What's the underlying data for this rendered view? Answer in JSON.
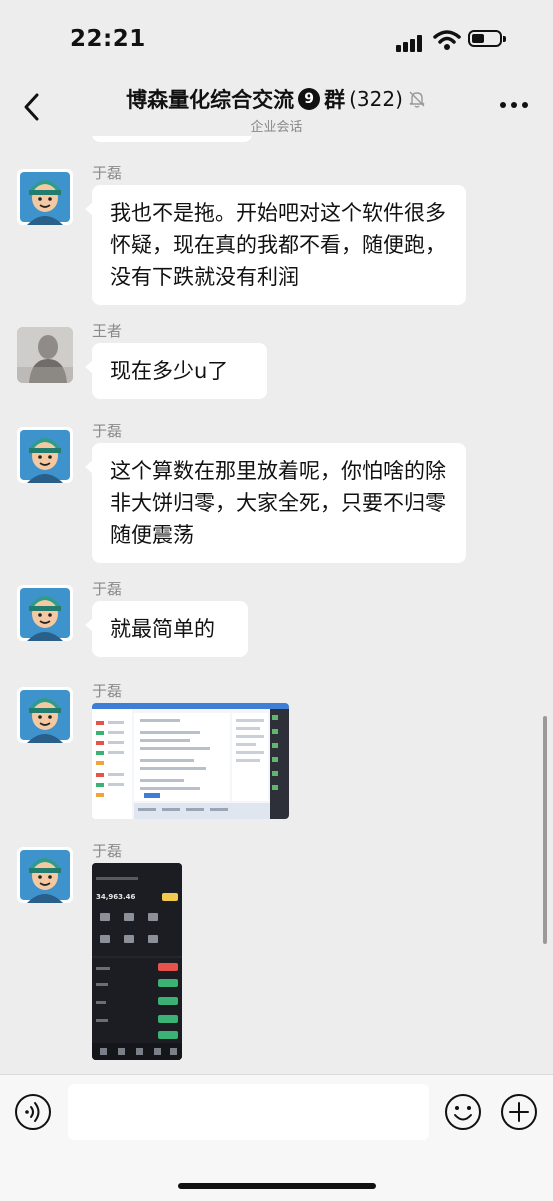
{
  "status_bar": {
    "time": "22:21"
  },
  "header": {
    "title": "博森量化综合交流",
    "title_badge": "9",
    "title_suffix": "群",
    "member_count": "(322)",
    "subtitle": "企业会话",
    "icons": {
      "back": "chevron-left-icon",
      "mute": "bell-slash-icon",
      "more": "more-dots-icon"
    }
  },
  "messages": [
    {
      "sender": "于磊",
      "type": "text",
      "text": "我也不是拖。开始吧对这个软件很多怀疑，现在真的我都不看，随便跑，没有下跌就没有利润"
    },
    {
      "sender": "王者",
      "type": "text",
      "text": "现在多少u了"
    },
    {
      "sender": "于磊",
      "type": "text",
      "text": "这个算数在那里放着呢，你怕啥的除非大饼归零，大家全死，只要不归零随便震荡"
    },
    {
      "sender": "于磊",
      "type": "text",
      "text": "就最简单的"
    },
    {
      "sender": "于磊",
      "type": "image",
      "image_kind": "trading-dashboard-screenshot"
    },
    {
      "sender": "于磊",
      "type": "image",
      "image_kind": "mobile-wallet-screenshot",
      "balance": "34,963.46"
    }
  ],
  "input_bar": {
    "placeholder": "",
    "icons": {
      "voice": "voice-icon",
      "emoji": "emoji-icon",
      "plus": "plus-icon"
    }
  },
  "colors": {
    "background": "#ededed",
    "bubble": "#ffffff",
    "dark_image": "#1c1d22",
    "sender_name": "#8a8a8a"
  }
}
